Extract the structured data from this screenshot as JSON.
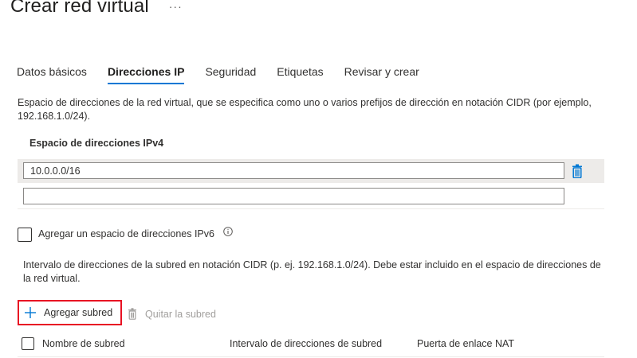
{
  "header": {
    "title": "Crear red virtual",
    "more": "···"
  },
  "tabs": [
    {
      "label": "Datos básicos",
      "active": false
    },
    {
      "label": "Direcciones IP",
      "active": true
    },
    {
      "label": "Seguridad",
      "active": false
    },
    {
      "label": "Etiquetas",
      "active": false
    },
    {
      "label": "Revisar y crear",
      "active": false
    }
  ],
  "address_space": {
    "description": "Espacio de direcciones de la red virtual, que se especifica como uno o varios prefijos de dirección en notación CIDR (por ejemplo, 192.168.1.0/24).",
    "ipv4_header": "Espacio de direcciones IPv4",
    "ipv4_rows": [
      {
        "value": "10.0.0.0/16"
      },
      {
        "value": ""
      }
    ]
  },
  "ipv6": {
    "label": "Agregar un espacio de direcciones IPv6",
    "checked": false,
    "info_icon": "info-icon"
  },
  "subnets": {
    "description": "Intervalo de direcciones de la subred en notación CIDR (p. ej. 192.168.1.0/24). Debe estar incluido en el espacio de direcciones de la red virtual.",
    "add_label": "Agregar subred",
    "remove_label": "Quitar la subred",
    "columns": [
      "Nombre de subred",
      "Intervalo de direcciones de subred",
      "Puerta de enlace NAT"
    ]
  },
  "colors": {
    "accent": "#0078d4",
    "highlight_border": "#e81123",
    "delete_icon": "#0078d4",
    "disabled": "#a19f9d"
  }
}
